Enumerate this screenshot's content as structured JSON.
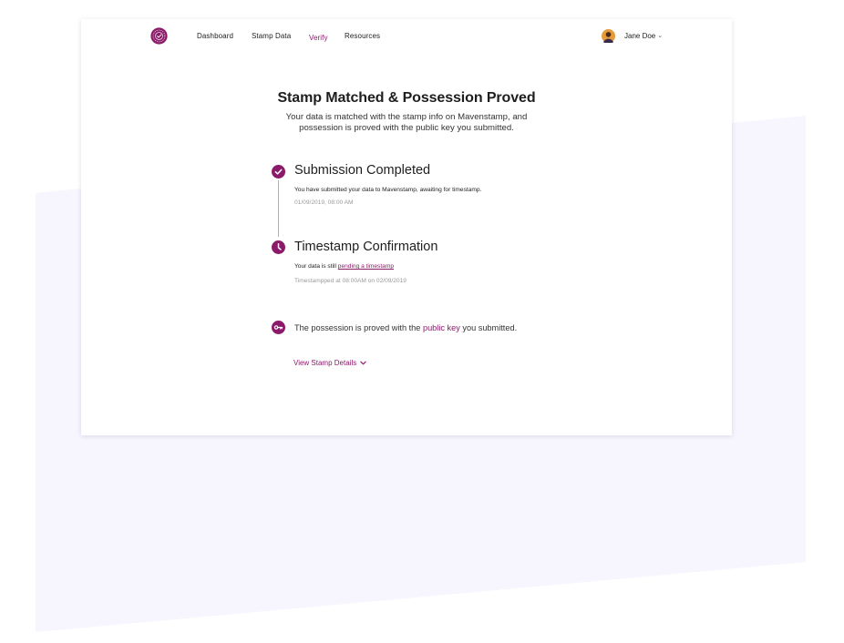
{
  "nav": {
    "links": [
      {
        "label": "Dashboard"
      },
      {
        "label": "Stamp Data"
      },
      {
        "label": "Verify"
      },
      {
        "label": "Resources"
      }
    ],
    "active": "Verify",
    "user": {
      "name": "Jane Doe"
    }
  },
  "header": {
    "title": "Stamp Matched & Possession Proved",
    "subtitle": "Your data is matched with the stamp info on Mavenstamp, and possession is proved with the public key you submitted."
  },
  "steps": [
    {
      "icon": "check-circle-icon",
      "title": "Submission Completed",
      "description": "You have submitted your data to Mavenstamp, awaiting for timestamp.",
      "meta": "01/09/2019, 08:00 AM"
    },
    {
      "icon": "clock-icon",
      "title": "Timestamp Confirmation",
      "description_prefix": "Your data is still ",
      "description_link": "pending a timestamp",
      "meta": "Timestampped at 08:00AM on 02/09/2019"
    }
  ],
  "possession": {
    "icon": "key-icon",
    "prefix": "The possession is proved with the ",
    "link": "public key",
    "suffix": " you submitted."
  },
  "details": {
    "label": "View Stamp Details"
  },
  "colors": {
    "brand": "#8c1a6a",
    "background_shape": "#f7f5fd",
    "muted_text": "#9a9a9a"
  }
}
